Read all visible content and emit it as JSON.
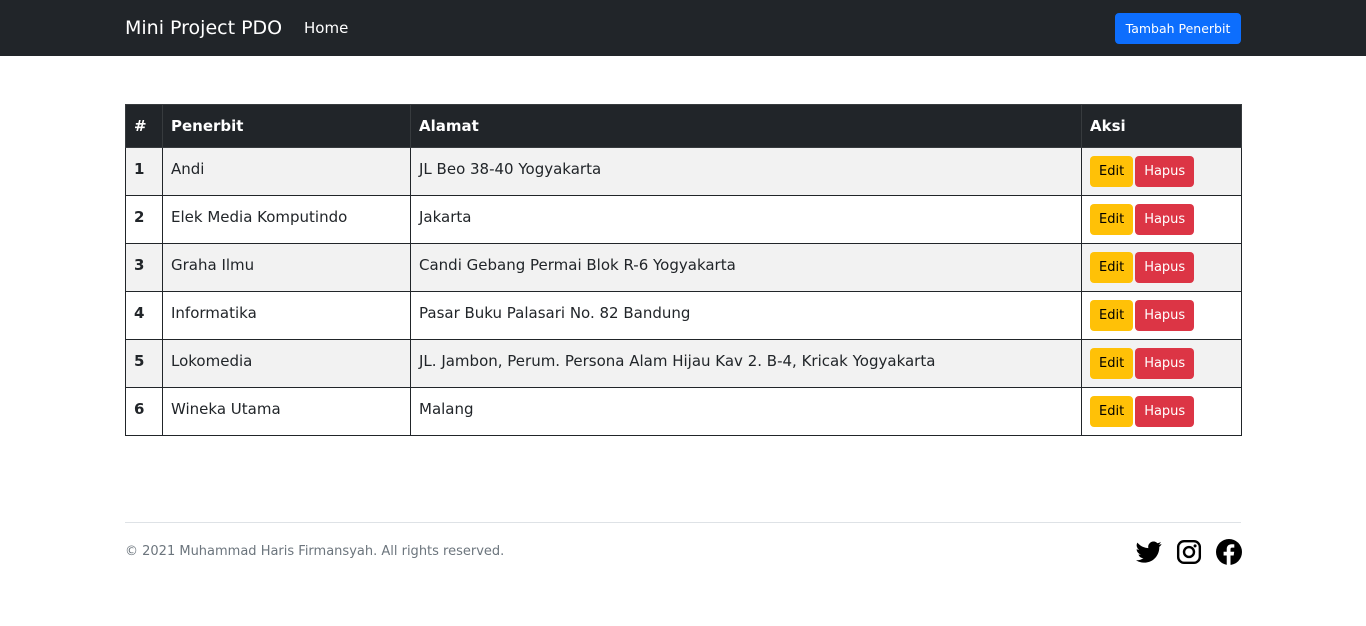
{
  "navbar": {
    "brand": "Mini Project PDO",
    "home_label": "Home",
    "add_button_label": "Tambah Penerbit"
  },
  "table": {
    "headers": [
      "#",
      "Penerbit",
      "Alamat",
      "Aksi"
    ],
    "rows": [
      {
        "no": "1",
        "penerbit": "Andi",
        "alamat": "JL Beo 38-40 Yogyakarta"
      },
      {
        "no": "2",
        "penerbit": "Elek Media Komputindo",
        "alamat": "Jakarta"
      },
      {
        "no": "3",
        "penerbit": "Graha Ilmu",
        "alamat": "Candi Gebang Permai Blok R-6 Yogyakarta"
      },
      {
        "no": "4",
        "penerbit": "Informatika",
        "alamat": "Pasar Buku Palasari No. 82 Bandung"
      },
      {
        "no": "5",
        "penerbit": "Lokomedia",
        "alamat": "JL. Jambon, Perum. Persona Alam Hijau Kav 2. B-4, Kricak Yogyakarta"
      },
      {
        "no": "6",
        "penerbit": "Wineka Utama",
        "alamat": "Malang"
      }
    ],
    "edit_label": "Edit",
    "delete_label": "Hapus"
  },
  "footer": {
    "copyright": "© 2021 Muhammad Haris Firmansyah. All rights reserved.",
    "social_icons": [
      "twitter-icon",
      "instagram-icon",
      "facebook-icon"
    ]
  },
  "colors": {
    "navbar_bg": "#212529",
    "primary": "#0d6efd",
    "warning": "#ffc107",
    "danger": "#dc3545",
    "muted_text": "#6c757d"
  }
}
